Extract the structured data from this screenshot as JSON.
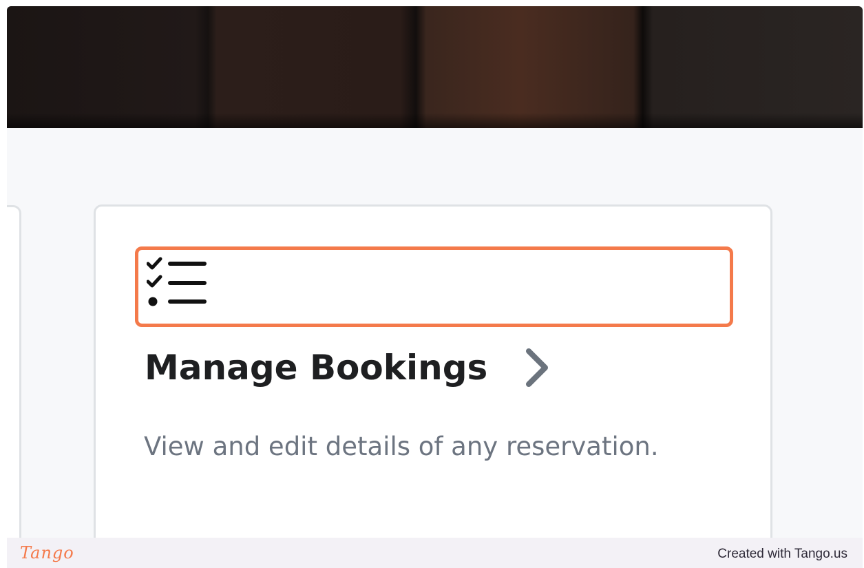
{
  "card": {
    "icon": "checklist-icon",
    "title": "Manage Bookings",
    "chevron_icon": "chevron-right-icon",
    "description": "View and edit details of any reservation."
  },
  "footer": {
    "logo": "Tango",
    "credit": "Created with Tango.us"
  },
  "colors": {
    "highlight": "#f47a4b",
    "title": "#1e1f21",
    "description": "#6c7480",
    "chevron": "#6b737d",
    "page_background": "#f7f8fa",
    "footer_background": "#f3f1f6"
  }
}
